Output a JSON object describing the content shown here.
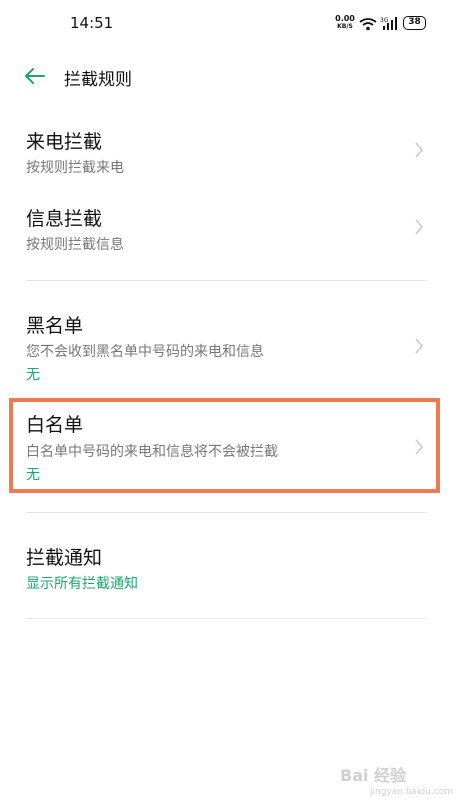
{
  "status_bar": {
    "time": "14:51",
    "net_speed_value": "0.00",
    "net_speed_unit": "KB/S",
    "battery": "38",
    "icons": [
      "wifi-icon",
      "signal-3g-icon",
      "battery-icon"
    ]
  },
  "header": {
    "title": "拦截规则",
    "back_icon": "arrow-left-icon"
  },
  "rows": [
    {
      "title": "来电拦截",
      "subtitle": "按规则拦截来电"
    },
    {
      "title": "信息拦截",
      "subtitle": "按规则拦截信息"
    },
    {
      "title": "黑名单",
      "subtitle": "您不会收到黑名单中号码的来电和信息",
      "status": "无"
    },
    {
      "title": "白名单",
      "subtitle": "白名单中号码的来电和信息将不会被拦截",
      "status": "无",
      "highlighted": true
    },
    {
      "title": "拦截通知",
      "status": "显示所有拦截通知"
    }
  ],
  "colors": {
    "accent": "#1aa86a",
    "highlight_border": "#ee7a52",
    "divider": "#e4e4e4"
  },
  "watermark": {
    "text": "Bai 经验",
    "sub": "jingyan.baidu.com"
  }
}
